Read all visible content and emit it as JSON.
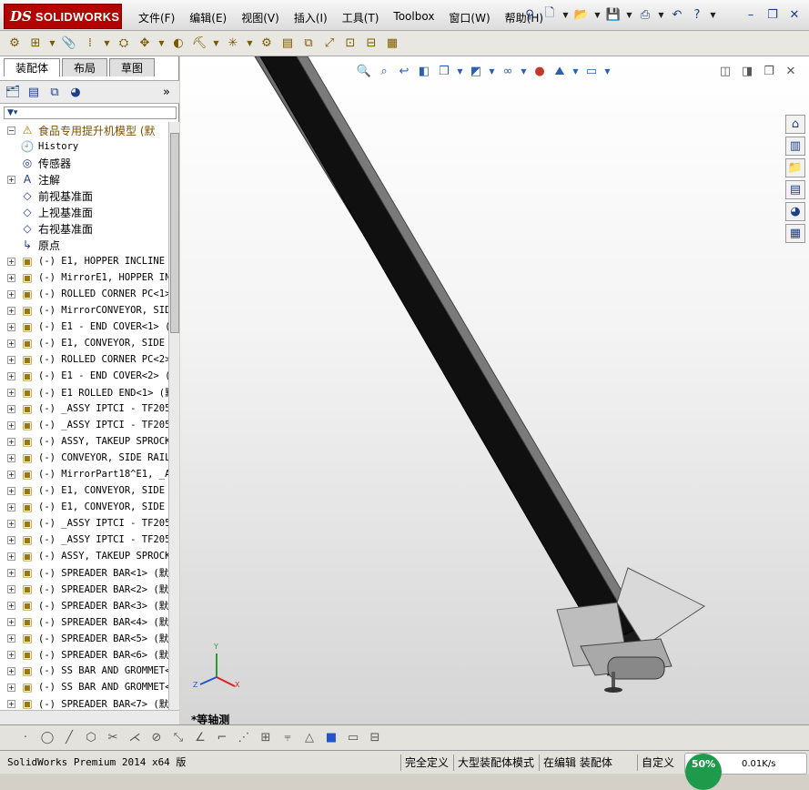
{
  "app": {
    "brand": "SOLIDWORKS",
    "logo_mark": "DS"
  },
  "menu": [
    "文件(F)",
    "编辑(E)",
    "视图(V)",
    "插入(I)",
    "工具(T)",
    "Toolbox",
    "窗口(W)",
    "帮助(H)"
  ],
  "icons": {
    "quickbar": [
      "pin-icon",
      "new-document-icon",
      "open-icon",
      "save-icon",
      "print-icon",
      "undo-icon",
      "help-icon",
      "restore-icon"
    ],
    "toolbar": [
      "edit-component-icon",
      "insert-component-icon",
      "mate-icon",
      "linear-pattern-icon",
      "smart-fastener-icon",
      "move-component-icon",
      "hide-show-icon",
      "assembly-features-icon",
      "reference-geometry-icon",
      "new-motion-study-icon",
      "bill-of-materials-icon",
      "exploded-view-icon",
      "explode-line-icon",
      "interference-icon",
      "clearance-icon",
      "instant3d-icon"
    ],
    "panel": [
      "featuremanager-icon",
      "propertymanager-icon",
      "configurationmanager-icon",
      "displaymanager-icon",
      "expand-panel-icon"
    ],
    "view": [
      "zoom-to-fit-icon",
      "zoom-area-icon",
      "previous-view-icon",
      "section-view-icon",
      "view-orientation-icon",
      "display-style-icon",
      "hide-show-items-icon",
      "edit-appearance-icon",
      "apply-scene-icon",
      "view-settings-icon"
    ],
    "taskpane": [
      "solidworks-resources-icon",
      "design-library-icon",
      "file-explorer-icon",
      "view-palette-icon",
      "appearances-icon",
      "custom-properties-icon"
    ],
    "bottom": [
      "point-icon",
      "circle-icon",
      "line-icon",
      "polygon-icon",
      "trim-icon",
      "mirror-icon",
      "offset-icon",
      "dimension-icon",
      "angle-icon",
      "rectangle-icon",
      "grid-icon",
      "coordinate-icon",
      "shaded-display-icon",
      "hidden-lines-icon",
      "wireframe-icon"
    ]
  },
  "panel": {
    "tabs": [
      "装配体",
      "布局",
      "草图"
    ],
    "filter_icon": "filter-icon"
  },
  "tree": [
    {
      "label": "食品专用提升机模型  (默",
      "icon": "assembly-warning-icon",
      "glyph": "⚠",
      "expand": "−",
      "root": true
    },
    {
      "label": "History",
      "icon": "history-icon",
      "glyph": "🕘",
      "expand": "",
      "mono": true
    },
    {
      "label": "传感器",
      "icon": "sensor-icon",
      "glyph": "◎",
      "expand": ""
    },
    {
      "label": "注解",
      "icon": "annotation-icon",
      "glyph": "A",
      "expand": "+"
    },
    {
      "label": "前视基准面",
      "icon": "plane-icon",
      "glyph": "◇",
      "expand": ""
    },
    {
      "label": "上视基准面",
      "icon": "plane-icon",
      "glyph": "◇",
      "expand": ""
    },
    {
      "label": "右视基准面",
      "icon": "plane-icon",
      "glyph": "◇",
      "expand": ""
    },
    {
      "label": "原点",
      "icon": "origin-icon",
      "glyph": "↳",
      "expand": ""
    },
    {
      "label": "(-) E1, HOPPER INCLINE",
      "icon": "assembly-icon",
      "glyph": "▣",
      "expand": "+",
      "mono": true
    },
    {
      "label": "(-) MirrorE1, HOPPER IN",
      "icon": "assembly-icon",
      "glyph": "▣",
      "expand": "+",
      "mono": true
    },
    {
      "label": "(-) ROLLED CORNER PC<1>",
      "icon": "assembly-icon",
      "glyph": "▣",
      "expand": "+",
      "mono": true
    },
    {
      "label": "(-) MirrorCONVEYOR, SID",
      "icon": "assembly-icon",
      "glyph": "▣",
      "expand": "+",
      "mono": true
    },
    {
      "label": "(-) E1 - END COVER<1> (",
      "icon": "assembly-icon",
      "glyph": "▣",
      "expand": "+",
      "mono": true
    },
    {
      "label": "(-) E1, CONVEYOR, SIDE",
      "icon": "assembly-icon",
      "glyph": "▣",
      "expand": "+",
      "mono": true
    },
    {
      "label": "(-) ROLLED CORNER PC<2>",
      "icon": "assembly-icon",
      "glyph": "▣",
      "expand": "+",
      "mono": true
    },
    {
      "label": "(-) E1 - END COVER<2> (",
      "icon": "assembly-icon",
      "glyph": "▣",
      "expand": "+",
      "mono": true
    },
    {
      "label": "(-) E1 ROLLED END<1> (默",
      "icon": "assembly-icon",
      "glyph": "▣",
      "expand": "+",
      "mono": true
    },
    {
      "label": "(-) _ASSY IPTCI - TF205",
      "icon": "assembly-icon",
      "glyph": "▣",
      "expand": "+",
      "mono": true
    },
    {
      "label": "(-) _ASSY IPTCI - TF205",
      "icon": "assembly-icon",
      "glyph": "▣",
      "expand": "+",
      "mono": true
    },
    {
      "label": "(-) ASSY, TAKEUP SPROCK",
      "icon": "assembly-icon",
      "glyph": "▣",
      "expand": "+",
      "mono": true
    },
    {
      "label": "(-) CONVEYOR, SIDE RAIL",
      "icon": "assembly-icon",
      "glyph": "▣",
      "expand": "+",
      "mono": true
    },
    {
      "label": "(-) MirrorPart18^E1, _A",
      "icon": "assembly-icon",
      "glyph": "▣",
      "expand": "+",
      "mono": true
    },
    {
      "label": "(-) E1, CONVEYOR, SIDE",
      "icon": "assembly-icon",
      "glyph": "▣",
      "expand": "+",
      "mono": true
    },
    {
      "label": "(-) E1, CONVEYOR, SIDE",
      "icon": "assembly-icon",
      "glyph": "▣",
      "expand": "+",
      "mono": true
    },
    {
      "label": "(-) _ASSY IPTCI - TF205",
      "icon": "assembly-icon",
      "glyph": "▣",
      "expand": "+",
      "mono": true
    },
    {
      "label": "(-) _ASSY IPTCI - TF205",
      "icon": "assembly-icon",
      "glyph": "▣",
      "expand": "+",
      "mono": true
    },
    {
      "label": "(-) ASSY, TAKEUP SPROCK",
      "icon": "assembly-icon",
      "glyph": "▣",
      "expand": "+",
      "mono": true
    },
    {
      "label": "(-) SPREADER BAR<1> (默",
      "icon": "assembly-icon",
      "glyph": "▣",
      "expand": "+",
      "mono": true
    },
    {
      "label": "(-) SPREADER BAR<2> (默",
      "icon": "assembly-icon",
      "glyph": "▣",
      "expand": "+",
      "mono": true
    },
    {
      "label": "(-) SPREADER BAR<3> (默",
      "icon": "assembly-icon",
      "glyph": "▣",
      "expand": "+",
      "mono": true
    },
    {
      "label": "(-) SPREADER BAR<4> (默",
      "icon": "assembly-icon",
      "glyph": "▣",
      "expand": "+",
      "mono": true
    },
    {
      "label": "(-) SPREADER BAR<5> (默",
      "icon": "assembly-icon",
      "glyph": "▣",
      "expand": "+",
      "mono": true
    },
    {
      "label": "(-) SPREADER BAR<6> (默",
      "icon": "assembly-icon",
      "glyph": "▣",
      "expand": "+",
      "mono": true
    },
    {
      "label": "(-) SS BAR AND GROMMET<",
      "icon": "assembly-icon",
      "glyph": "▣",
      "expand": "+",
      "mono": true
    },
    {
      "label": "(-) SS BAR AND GROMMET<",
      "icon": "assembly-icon",
      "glyph": "▣",
      "expand": "+",
      "mono": true
    },
    {
      "label": "(-) SPREADER BAR<7> (默",
      "icon": "assembly-icon",
      "glyph": "▣",
      "expand": "+",
      "mono": true
    }
  ],
  "viewport": {
    "view_name": "*等轴测",
    "triad": {
      "x": "X",
      "y": "Y",
      "z": "Z"
    }
  },
  "status": {
    "product": "SolidWorks Premium 2014 x64 版",
    "defined": "完全定义",
    "mode": "大型装配体模式",
    "editing": "在编辑 装配体",
    "custom": "自定义",
    "net_percent": "50%",
    "net_speed": "0.01K/s"
  },
  "colors": {
    "brand": "#b30000",
    "accent": "#1f9a4a"
  }
}
